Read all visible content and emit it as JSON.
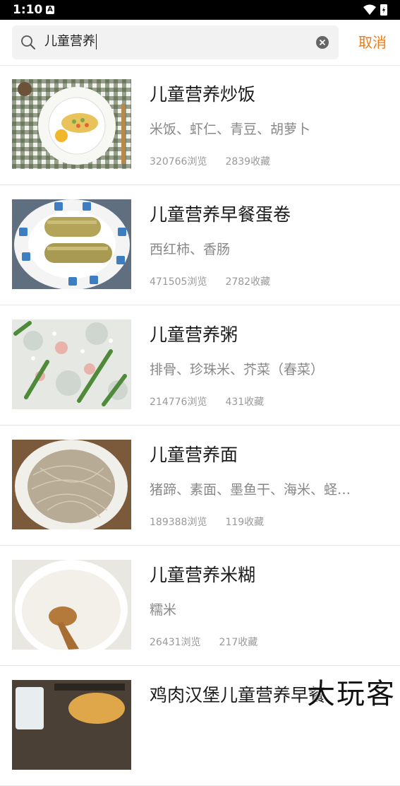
{
  "status_bar": {
    "time": "1:10",
    "notification_letter": "A"
  },
  "search": {
    "query": "儿童营养",
    "cancel_label": "取消"
  },
  "recipes": [
    {
      "title": "儿童营养炒饭",
      "ingredients": "米饭、虾仁、青豆、胡萝卜",
      "views": "320766浏览",
      "favorites": "2839收藏"
    },
    {
      "title": "儿童营养早餐蛋卷",
      "ingredients": "西红柿、香肠",
      "views": "471505浏览",
      "favorites": "2782收藏"
    },
    {
      "title": "儿童营养粥",
      "ingredients": "排骨、珍珠米、芥菜（春菜）",
      "views": "214776浏览",
      "favorites": "431收藏"
    },
    {
      "title": "儿童营养面",
      "ingredients": "猪蹄、素面、墨鱼干、海米、蛏…",
      "views": "189388浏览",
      "favorites": "119收藏"
    },
    {
      "title": "儿童营养米糊",
      "ingredients": "糯米",
      "views": "26431浏览",
      "favorites": "217收藏"
    },
    {
      "title": "鸡肉汉堡儿童营养早餐",
      "ingredients": "",
      "views": "",
      "favorites": ""
    }
  ],
  "watermark": "大玩客",
  "colors": {
    "accent": "#ef7a17",
    "title": "#1a1a1a",
    "subtle": "#888888"
  }
}
